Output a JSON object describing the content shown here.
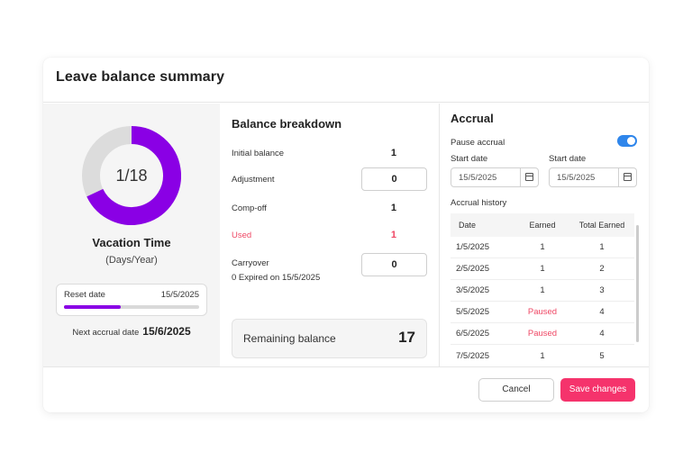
{
  "modal": {
    "title": "Leave balance summary"
  },
  "summary": {
    "donut_text": "1/18",
    "used": 1,
    "total": 18,
    "leave_type": "Vacation Time",
    "unit": "(Days/Year)",
    "reset_label": "Reset date",
    "reset_date": "15/5/2025",
    "reset_progress": 0.42,
    "next_accrual_label": "Next accrual date",
    "next_accrual_date": "15/6/2025",
    "accent": "#8a00e5",
    "track": "#dcdcdc"
  },
  "breakdown": {
    "title": "Balance breakdown",
    "initial_label": "Initial balance",
    "initial_value": "1",
    "adjustment_label": "Adjustment",
    "adjustment_value": "0",
    "compoff_label": "Comp-off",
    "compoff_value": "1",
    "used_label": "Used",
    "used_value": "1",
    "carryover_label": "Carryover",
    "carryover_sub": "0 Expired on 15/5/2025",
    "carryover_value": "0",
    "remaining_label": "Remaining balance",
    "remaining_value": "17"
  },
  "accrual": {
    "title": "Accrual",
    "pause_label": "Pause accrual",
    "pause_on": true,
    "start_date_label_1": "Start date",
    "start_date_1": "15/5/2025",
    "start_date_label_2": "Start date",
    "start_date_2": "15/5/2025",
    "history_label": "Accrual history",
    "columns": [
      "Date",
      "Earned",
      "Total Earned"
    ],
    "rows": [
      {
        "date": "1/5/2025",
        "earned": "1",
        "total": "1"
      },
      {
        "date": "2/5/2025",
        "earned": "1",
        "total": "2"
      },
      {
        "date": "3/5/2025",
        "earned": "1",
        "total": "3"
      },
      {
        "date": "5/5/2025",
        "earned": "Paused",
        "total": "4"
      },
      {
        "date": "6/5/2025",
        "earned": "Paused",
        "total": "4"
      },
      {
        "date": "7/5/2025",
        "earned": "1",
        "total": "5"
      }
    ]
  },
  "footer": {
    "cancel_label": "Cancel",
    "save_label": "Save changes"
  }
}
